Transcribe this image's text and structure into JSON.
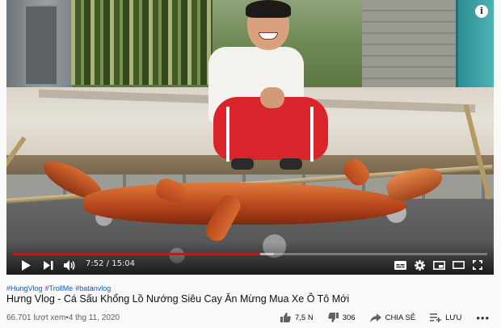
{
  "player": {
    "current_time": "7:52",
    "duration": "15:04",
    "time_separator": " / ",
    "progress": 0.521,
    "buffered": 0.55
  },
  "video": {
    "hashtags": [
      "#HungVlog",
      "#TrollMe",
      "#batanvlog"
    ],
    "title": "Hưng Vlog - Cá Sấu Khổng Lồ Nướng Siêu Cay Ăn Mừng Mua Xe Ô Tô Mới",
    "views": "66.701 lượt xem",
    "date_separator": " • ",
    "date": "4 thg 11, 2020"
  },
  "actions": {
    "likes": "7,5 N",
    "dislikes": "306",
    "share_label": "CHIA SẺ",
    "save_label": "LƯU"
  },
  "icons": {
    "info": "info-icon",
    "play": "play-icon",
    "next": "next-icon",
    "volume": "volume-icon",
    "captions": "subtitles-icon",
    "settings": "gear-icon",
    "miniplayer": "miniplayer-icon",
    "theater": "theater-icon",
    "fullscreen": "fullscreen-icon",
    "like": "thumbs-up-icon",
    "dislike": "thumbs-down-icon",
    "share": "share-icon",
    "save": "playlist-add-icon",
    "more": "more-icon"
  },
  "colors": {
    "progress": "#ff0000",
    "link": "#065fd4",
    "text": "#0f0f0f",
    "muted": "#606060"
  }
}
